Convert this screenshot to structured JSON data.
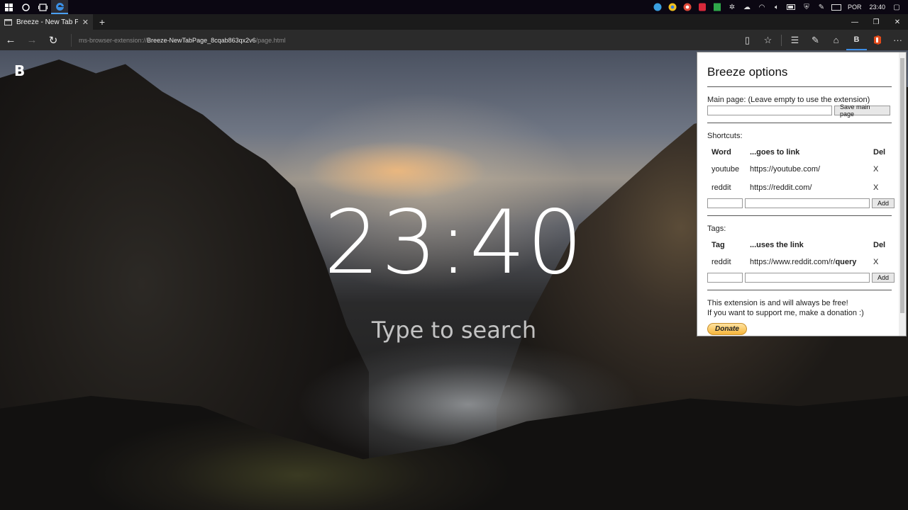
{
  "taskbar": {
    "tray_lang": "POR",
    "tray_time": "23:40"
  },
  "browser": {
    "tab_title": "Breeze - New Tab Page",
    "url_prefix": "ms-browser-extension://",
    "url_host": "Breeze-NewTabPage_8cqab863qx2v6",
    "url_path": "/page.html",
    "extension_badge": "B"
  },
  "page": {
    "logo": "B",
    "clock": "23:40",
    "search_placeholder": "Type to search"
  },
  "options": {
    "title": "Breeze options",
    "main_page_label": "Main page: (Leave empty to use the extension)",
    "main_page_value": "",
    "save_main_label": "Save main page",
    "shortcuts_label": "Shortcuts:",
    "shortcuts_headers": {
      "word": "Word",
      "link": "...goes to link",
      "del": "Del"
    },
    "shortcuts": [
      {
        "word": "youtube",
        "link": "https://youtube.com/",
        "del": "X"
      },
      {
        "word": "reddit",
        "link": "https://reddit.com/",
        "del": "X"
      }
    ],
    "add_label": "Add",
    "tags_label": "Tags:",
    "tags_headers": {
      "tag": "Tag",
      "link": "...uses the link",
      "del": "Del"
    },
    "tags": [
      {
        "tag": "reddit",
        "link_prefix": "https://www.reddit.com/r/",
        "link_query": "query",
        "del": "X"
      }
    ],
    "free_text": "This extension is and will always be free!",
    "support_text": "If you want to support me, make a donation :)",
    "donate_label": "Donate"
  }
}
